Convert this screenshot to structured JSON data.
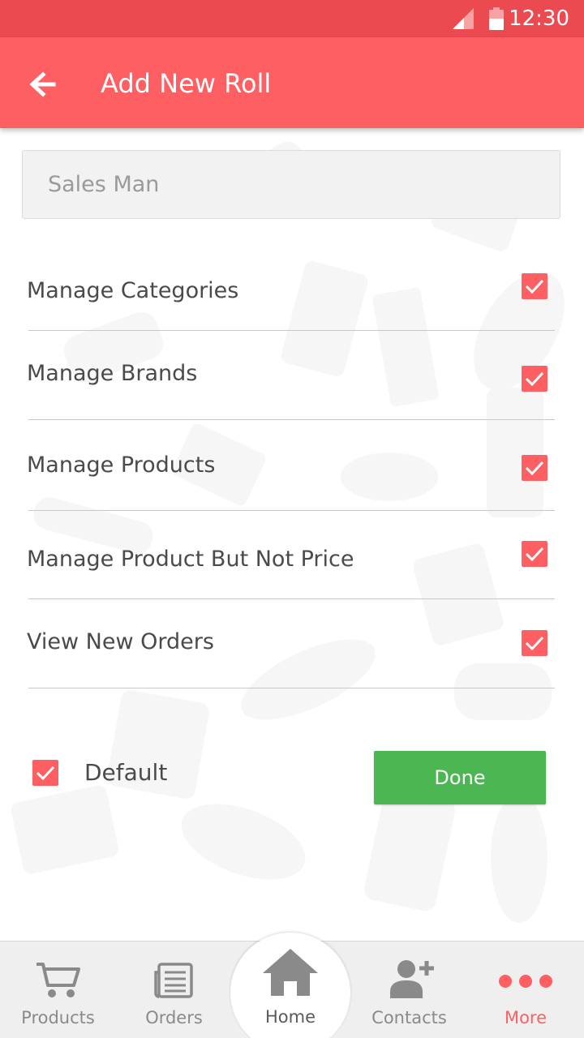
{
  "status_bar": {
    "time": "12:30"
  },
  "app_bar": {
    "title": "Add New Roll"
  },
  "role_input": {
    "placeholder": "Sales Man",
    "value": ""
  },
  "permissions": [
    {
      "label": "Manage Categories",
      "checked": true
    },
    {
      "label": "Manage Brands",
      "checked": true
    },
    {
      "label": "Manage Products",
      "checked": true
    },
    {
      "label": "Manage Product But Not Price",
      "checked": true
    },
    {
      "label": "View New Orders",
      "checked": true
    }
  ],
  "default_option": {
    "label": "Default",
    "checked": true
  },
  "done_button": {
    "label": "Done"
  },
  "bottom_nav": {
    "items": [
      {
        "label": "Products",
        "icon": "cart-icon",
        "active": false
      },
      {
        "label": "Orders",
        "icon": "newspaper-icon",
        "active": false
      },
      {
        "label": "Home",
        "icon": "home-icon",
        "active": false
      },
      {
        "label": "Contacts",
        "icon": "add-user-icon",
        "active": false
      },
      {
        "label": "More",
        "icon": "more-dots-icon",
        "active": true
      }
    ]
  },
  "colors": {
    "status_bar": "#ec4a51",
    "app_bar": "#fe5f62",
    "checkbox": "#fe5f62",
    "done_button": "#4cb752",
    "nav_active": "#fe5f62",
    "nav_inactive": "#8a8a8a"
  }
}
